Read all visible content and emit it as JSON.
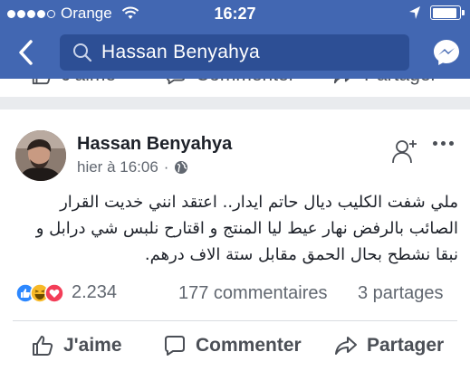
{
  "status_bar": {
    "carrier": "Orange",
    "time": "16:27",
    "signal_bars_filled": 4,
    "signal_bars_total": 5,
    "battery_level": 0.9
  },
  "nav": {
    "search_text": "Hassan Benyahya"
  },
  "prev_post": {
    "like_label": "J'aime",
    "comment_label": "Commenter",
    "share_label": "Partager"
  },
  "post": {
    "author": "Hassan Benyahya",
    "timestamp": "hier à 16:06",
    "separator": "·",
    "text": "ملي شفت الكليب ديال حاتم ايدار..   اعتقد انني خديت القرار الصائب بالرفض نهار عيط ليا المنتج و اقتارح نلبس شي درابل و نبقا نشطح بحال الحمق مقابل ستة الاف درهم.",
    "reactions_count": "2.234",
    "comments_count": "177 commentaires",
    "shares_count": "3 partages",
    "actions": {
      "like": "J'aime",
      "comment": "Commenter",
      "share": "Partager"
    }
  },
  "icons": {
    "header_bg": "#4267b2",
    "search_bg": "#2d4f95",
    "like_color": "#2d88ff",
    "haha_color": "#f7b928",
    "love_color": "#f33e58"
  }
}
